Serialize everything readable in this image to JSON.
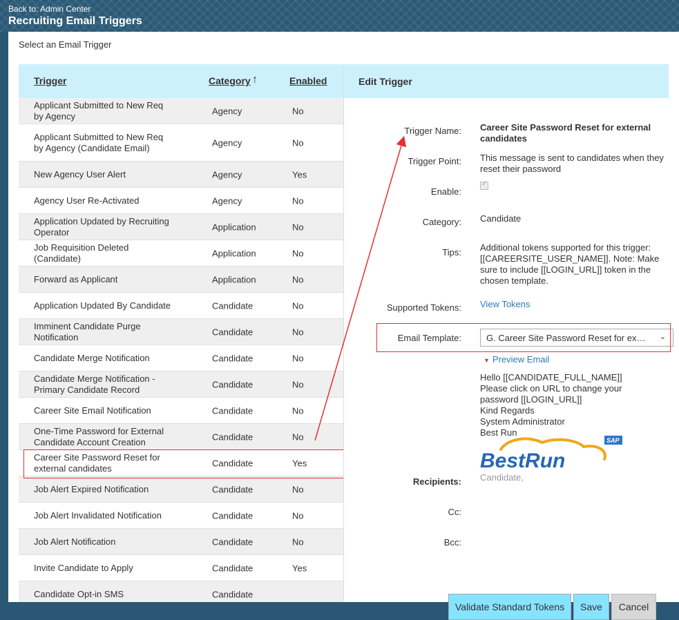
{
  "header": {
    "back_link": "Back to: Admin Center",
    "title": "Recruiting Email Triggers"
  },
  "main": {
    "select_label": "Select an Email Trigger"
  },
  "table": {
    "headers": {
      "trigger": "Trigger",
      "category": "Category",
      "enabled": "Enabled"
    },
    "sort_arrow": "🡑",
    "rows": [
      {
        "trigger": "Applicant Submitted to New Req by Agency",
        "category": "Agency",
        "enabled": "No"
      },
      {
        "trigger": "Applicant Submitted to New Req by Agency (Candidate Email)",
        "category": "Agency",
        "enabled": "No"
      },
      {
        "trigger": "New Agency User Alert",
        "category": "Agency",
        "enabled": "Yes"
      },
      {
        "trigger": "Agency User Re-Activated",
        "category": "Agency",
        "enabled": "No"
      },
      {
        "trigger": "Application Updated by Recruiting Operator",
        "category": "Application",
        "enabled": "No"
      },
      {
        "trigger": "Job Requisition Deleted (Candidate)",
        "category": "Application",
        "enabled": "No"
      },
      {
        "trigger": "Forward as Applicant",
        "category": "Application",
        "enabled": "No"
      },
      {
        "trigger": "Application Updated By Candidate",
        "category": "Candidate",
        "enabled": "No"
      },
      {
        "trigger": "Imminent Candidate Purge Notification",
        "category": "Candidate",
        "enabled": "No"
      },
      {
        "trigger": "Candidate Merge Notification",
        "category": "Candidate",
        "enabled": "No"
      },
      {
        "trigger": "Candidate Merge Notification - Primary Candidate Record",
        "category": "Candidate",
        "enabled": "No"
      },
      {
        "trigger": "Career Site Email Notification",
        "category": "Candidate",
        "enabled": "No"
      },
      {
        "trigger": "One-Time Password for External Candidate Account Creation",
        "category": "Candidate",
        "enabled": "No"
      },
      {
        "trigger": "Career Site Password Reset for external candidates",
        "category": "Candidate",
        "enabled": "Yes"
      },
      {
        "trigger": "Job Alert Expired Notification",
        "category": "Candidate",
        "enabled": "No"
      },
      {
        "trigger": "Job Alert Invalidated Notification",
        "category": "Candidate",
        "enabled": "No"
      },
      {
        "trigger": "Job Alert Notification",
        "category": "Candidate",
        "enabled": "No"
      },
      {
        "trigger": "Invite Candidate to Apply",
        "category": "Candidate",
        "enabled": "Yes"
      },
      {
        "trigger": "Candidate Opt-in SMS",
        "category": "Candidate",
        "enabled": ""
      }
    ]
  },
  "edit": {
    "title": "Edit Trigger",
    "labels": {
      "trigger_name": "Trigger Name:",
      "trigger_point": "Trigger Point:",
      "enable": "Enable:",
      "category": "Category:",
      "tips": "Tips:",
      "supported_tokens": "Supported Tokens:",
      "email_template": "Email Template:",
      "recipients": "Recipients:",
      "cc": "Cc:",
      "bcc": "Bcc:"
    },
    "trigger_name": "Career Site Password Reset for external candidates",
    "trigger_point": "This message is sent to candidates when they reset their password",
    "enabled": true,
    "category": "Candidate",
    "tips": "Additional tokens supported for this trigger: [[CAREERSITE_USER_NAME]]. Note: Make sure to include [[LOGIN_URL]] token in the chosen template.",
    "view_tokens": "View Tokens",
    "email_template": "G. Career Site Password Reset for ex…",
    "preview_email": "Preview Email",
    "email_lines": [
      "Hello [[CANDIDATE_FULL_NAME]]",
      "Please click on URL to change your",
      "password [[LOGIN_URL]]",
      "Kind Regards",
      "System Administrator",
      "Best Run"
    ],
    "logo_text": "BestRun",
    "logo_badge": "SAP",
    "recipients": "Candidate,",
    "buttons": {
      "validate": "Validate Standard Tokens",
      "save": "Save",
      "cancel": "Cancel"
    }
  },
  "colors": {
    "accent": "#87e3ff",
    "header_bg": "#cdf0fd",
    "highlight": "#e53030",
    "link": "#2b7bb9"
  }
}
